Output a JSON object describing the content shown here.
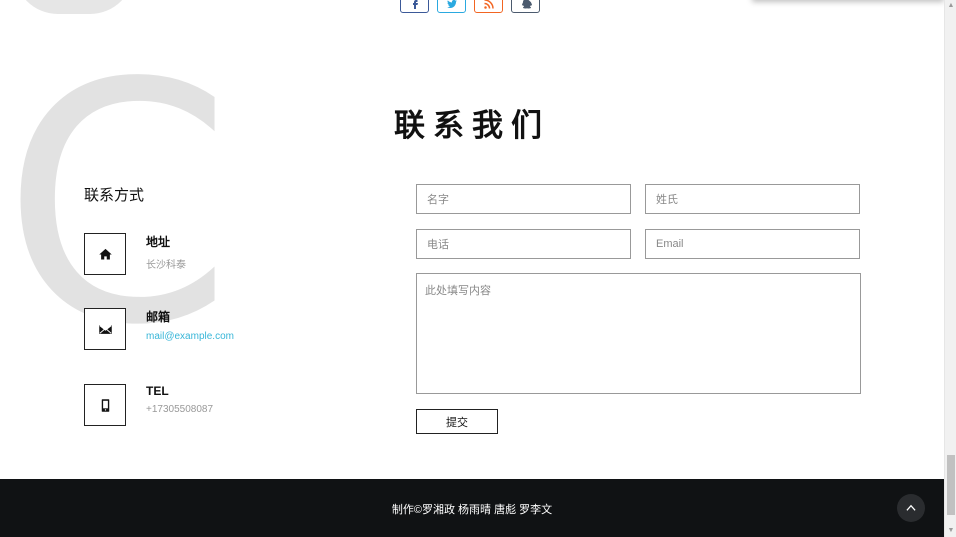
{
  "social": [
    {
      "name": "facebook",
      "icon": "facebook-icon",
      "color": "#3b5998"
    },
    {
      "name": "twitter",
      "icon": "twitter-icon",
      "color": "#2aa9e0"
    },
    {
      "name": "rss",
      "icon": "rss-icon",
      "color": "#f26522"
    },
    {
      "name": "qq",
      "icon": "qq-icon",
      "color": "#4b5a6e"
    }
  ],
  "decor": {
    "big_letter": "C"
  },
  "section": {
    "title": "联系我们"
  },
  "contact": {
    "heading": "联系方式",
    "items": [
      {
        "icon": "home-icon",
        "label": "地址",
        "value": "长沙科泰"
      },
      {
        "icon": "mail-icon",
        "label": "邮箱",
        "value": "mail@example.com"
      },
      {
        "icon": "phone-icon",
        "label": "TEL",
        "value": "+17305508087"
      }
    ]
  },
  "form": {
    "first_name_placeholder": "名字",
    "last_name_placeholder": "姓氏",
    "phone_placeholder": "电话",
    "email_placeholder": "Email",
    "message_placeholder": "此处填写内容",
    "submit_label": "提交"
  },
  "footer": {
    "credits": "制作©罗湘政  杨雨晴  唐彪  罗李文",
    "back_to_top_icon": "chevron-up-icon"
  },
  "colors": {
    "footer_bg": "#101214",
    "link": "#38b6d8"
  }
}
